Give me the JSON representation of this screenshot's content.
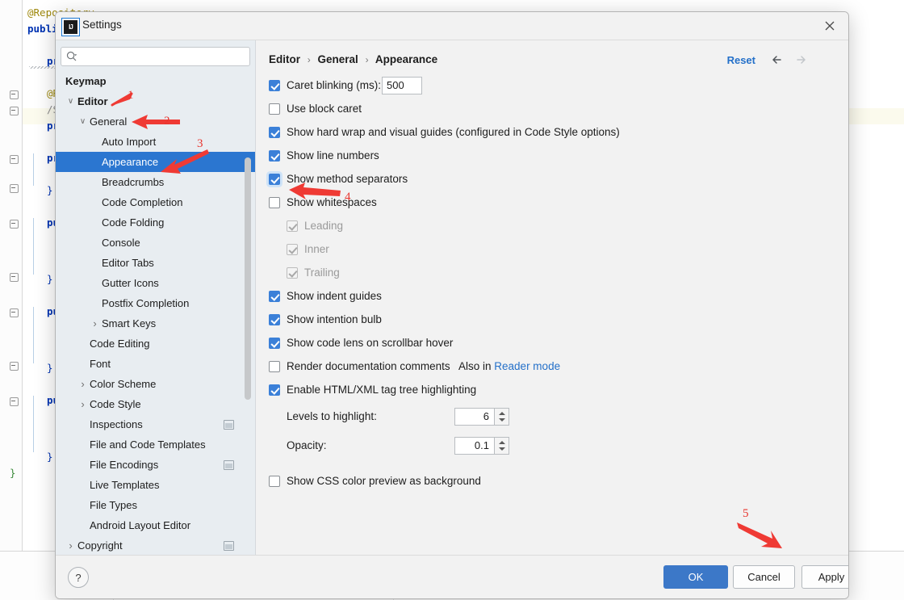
{
  "window": {
    "title": "Settings",
    "logo_text": "IJ",
    "close_icon": "close-icon"
  },
  "search": {
    "value": "",
    "placeholder": ""
  },
  "sidebar": {
    "items": [
      {
        "label": "Keymap",
        "indent": 12,
        "bold": true,
        "chevron": "",
        "selected": false,
        "pin": false
      },
      {
        "label": "Editor",
        "indent": 27,
        "bold": true,
        "chevron": "v",
        "selected": false,
        "pin": false
      },
      {
        "label": "General",
        "indent": 42,
        "bold": false,
        "chevron": "v",
        "selected": false,
        "pin": false
      },
      {
        "label": "Auto Import",
        "indent": 57,
        "bold": false,
        "chevron": "",
        "selected": false,
        "pin": false
      },
      {
        "label": "Appearance",
        "indent": 57,
        "bold": false,
        "chevron": "",
        "selected": true,
        "pin": false
      },
      {
        "label": "Breadcrumbs",
        "indent": 57,
        "bold": false,
        "chevron": "",
        "selected": false,
        "pin": false
      },
      {
        "label": "Code Completion",
        "indent": 57,
        "bold": false,
        "chevron": "",
        "selected": false,
        "pin": false
      },
      {
        "label": "Code Folding",
        "indent": 57,
        "bold": false,
        "chevron": "",
        "selected": false,
        "pin": false
      },
      {
        "label": "Console",
        "indent": 57,
        "bold": false,
        "chevron": "",
        "selected": false,
        "pin": false
      },
      {
        "label": "Editor Tabs",
        "indent": 57,
        "bold": false,
        "chevron": "",
        "selected": false,
        "pin": false
      },
      {
        "label": "Gutter Icons",
        "indent": 57,
        "bold": false,
        "chevron": "",
        "selected": false,
        "pin": false
      },
      {
        "label": "Postfix Completion",
        "indent": 57,
        "bold": false,
        "chevron": "",
        "selected": false,
        "pin": false
      },
      {
        "label": "Smart Keys",
        "indent": 57,
        "bold": false,
        "chevron": ">",
        "selected": false,
        "pin": false
      },
      {
        "label": "Code Editing",
        "indent": 42,
        "bold": false,
        "chevron": "",
        "selected": false,
        "pin": false
      },
      {
        "label": "Font",
        "indent": 42,
        "bold": false,
        "chevron": "",
        "selected": false,
        "pin": false
      },
      {
        "label": "Color Scheme",
        "indent": 42,
        "bold": false,
        "chevron": ">",
        "selected": false,
        "pin": false
      },
      {
        "label": "Code Style",
        "indent": 42,
        "bold": false,
        "chevron": ">",
        "selected": false,
        "pin": false
      },
      {
        "label": "Inspections",
        "indent": 42,
        "bold": false,
        "chevron": "",
        "selected": false,
        "pin": true
      },
      {
        "label": "File and Code Templates",
        "indent": 42,
        "bold": false,
        "chevron": "",
        "selected": false,
        "pin": false
      },
      {
        "label": "File Encodings",
        "indent": 42,
        "bold": false,
        "chevron": "",
        "selected": false,
        "pin": true
      },
      {
        "label": "Live Templates",
        "indent": 42,
        "bold": false,
        "chevron": "",
        "selected": false,
        "pin": false
      },
      {
        "label": "File Types",
        "indent": 42,
        "bold": false,
        "chevron": "",
        "selected": false,
        "pin": false
      },
      {
        "label": "Android Layout Editor",
        "indent": 42,
        "bold": false,
        "chevron": "",
        "selected": false,
        "pin": false
      },
      {
        "label": "Copyright",
        "indent": 27,
        "bold": false,
        "chevron": ">",
        "selected": false,
        "pin": true
      }
    ]
  },
  "main": {
    "breadcrumb": [
      "Editor",
      "General",
      "Appearance"
    ],
    "breadcrumb_separator": "›",
    "reset_label": "Reset",
    "back_icon": "arrow-left-icon",
    "forward_icon": "arrow-right-icon",
    "options": [
      {
        "label": "Caret blinking (ms):",
        "checked": true,
        "disabled": false,
        "field": "500"
      },
      {
        "label": "Use block caret",
        "checked": false,
        "disabled": false
      },
      {
        "label": "Show hard wrap and visual guides (configured in Code Style options)",
        "checked": true,
        "disabled": false
      },
      {
        "label": "Show line numbers",
        "checked": true,
        "disabled": false
      },
      {
        "label": "Show method separators",
        "checked": true,
        "disabled": false,
        "focused": true
      },
      {
        "label": "Show whitespaces",
        "checked": false,
        "disabled": false
      },
      {
        "label": "Leading",
        "checked": true,
        "disabled": true,
        "sub": true
      },
      {
        "label": "Inner",
        "checked": true,
        "disabled": true,
        "sub": true
      },
      {
        "label": "Trailing",
        "checked": true,
        "disabled": true,
        "sub": true
      },
      {
        "label": "Show indent guides",
        "checked": true,
        "disabled": false
      },
      {
        "label": "Show intention bulb",
        "checked": true,
        "disabled": false
      },
      {
        "label": "Show code lens on scrollbar hover",
        "checked": true,
        "disabled": false
      },
      {
        "label": "Render documentation comments",
        "checked": false,
        "disabled": false,
        "suffix_text": "Also in ",
        "suffix_link": "Reader mode"
      },
      {
        "label": "Enable HTML/XML tag tree highlighting",
        "checked": true,
        "disabled": false
      }
    ],
    "spinners": [
      {
        "label": "Levels to highlight:",
        "value": "6"
      },
      {
        "label": "Opacity:",
        "value": "0.1"
      }
    ],
    "last_option": {
      "label": "Show CSS color preview as background",
      "checked": false
    }
  },
  "footer": {
    "help_label": "?",
    "ok_label": "OK",
    "cancel_label": "Cancel",
    "apply_label": "Apply"
  },
  "annotations": {
    "numbers": [
      "1",
      "2",
      "3",
      "4",
      "5"
    ],
    "color": "#e8352e"
  },
  "editor_background": {
    "lines": [
      "@Repository",
      "public c",
      "priv",
      "@Res",
      "/Spr",
      "priv",
      "priv",
      "}",
      "publ",
      "}",
      "publ",
      "}",
      "publ",
      "}",
      "}"
    ]
  }
}
